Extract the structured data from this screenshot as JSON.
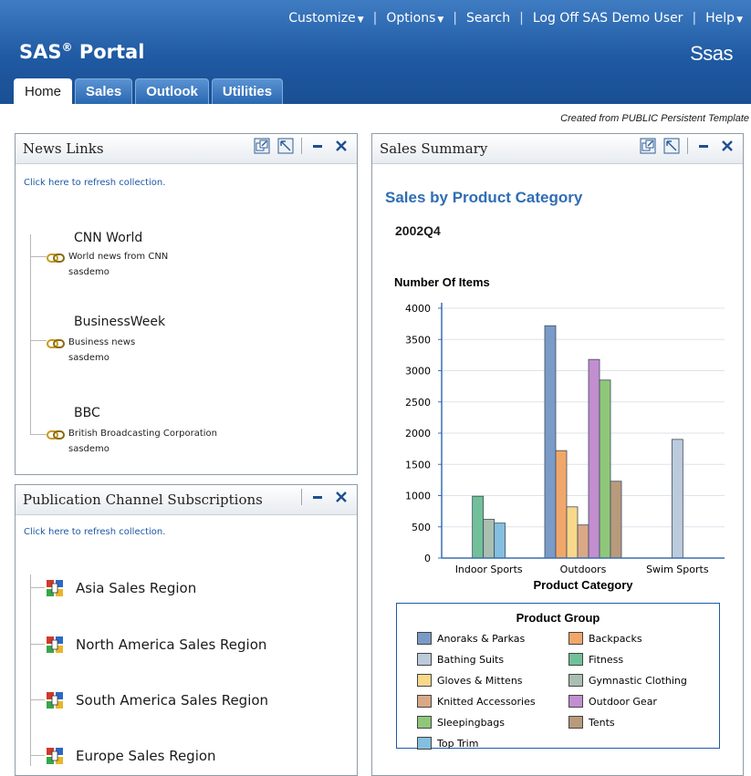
{
  "header": {
    "nav": [
      {
        "label": "Customize",
        "dropdown": true
      },
      {
        "label": "Options",
        "dropdown": true
      },
      {
        "label": "Search",
        "dropdown": false
      },
      {
        "label": "Log Off SAS Demo User",
        "dropdown": false
      },
      {
        "label": "Help",
        "dropdown": true
      }
    ],
    "portal_name": "SAS",
    "portal_reg": "®",
    "portal_suffix": "Portal",
    "logo_text": "Ssas",
    "tabs": [
      "Home",
      "Sales",
      "Outlook",
      "Utilities"
    ],
    "active_tab": "Home"
  },
  "template_note": "Created from PUBLIC Persistent Template",
  "news_links": {
    "title": "News Links",
    "refresh_text": "Click here to refresh collection.",
    "items": [
      {
        "title": "CNN World",
        "description": "World news from CNN",
        "owner": "sasdemo"
      },
      {
        "title": "BusinessWeek",
        "description": "Business news",
        "owner": "sasdemo"
      },
      {
        "title": "BBC",
        "description": "British Broadcasting Corporation",
        "owner": "sasdemo"
      }
    ]
  },
  "publication_channels": {
    "title": "Publication Channel Subscriptions",
    "refresh_text": "Click here to refresh collection.",
    "items": [
      "Asia Sales Region",
      "North America Sales Region",
      "South America Sales Region",
      "Europe Sales Region"
    ]
  },
  "sales_summary": {
    "title": "Sales Summary",
    "heading": "Sales by Product Category",
    "period": "2002Q4"
  },
  "chart_data": {
    "type": "bar",
    "title": "",
    "xlabel": "Product Category",
    "ylabel": "Number Of Items",
    "ylim": [
      0,
      4000
    ],
    "yticks": [
      0,
      500,
      1000,
      1500,
      2000,
      2500,
      3000,
      3500,
      4000
    ],
    "grid": true,
    "categories": [
      "Indoor Sports",
      "Outdoors",
      "Swim Sports"
    ],
    "legend_title": "Product Group",
    "legend_position": "bottom",
    "series": [
      {
        "name": "Anoraks & Parkas",
        "color": "#7a9bc7",
        "values": [
          null,
          3720,
          null
        ]
      },
      {
        "name": "Backpacks",
        "color": "#f1a76a",
        "values": [
          null,
          1720,
          null
        ]
      },
      {
        "name": "Bathing Suits",
        "color": "#bccbdc",
        "values": [
          null,
          null,
          1900
        ]
      },
      {
        "name": "Fitness",
        "color": "#72c09a",
        "values": [
          990,
          null,
          null
        ]
      },
      {
        "name": "Gloves & Mittens",
        "color": "#f8d88a",
        "values": [
          null,
          820,
          null
        ]
      },
      {
        "name": "Gymnastic Clothing",
        "color": "#a9bfb0",
        "values": [
          620,
          null,
          null
        ]
      },
      {
        "name": "Knitted Accessories",
        "color": "#d9a887",
        "values": [
          null,
          530,
          null
        ]
      },
      {
        "name": "Outdoor Gear",
        "color": "#c28ed0",
        "values": [
          null,
          3180,
          null
        ]
      },
      {
        "name": "Sleepingbags",
        "color": "#8fc77a",
        "values": [
          null,
          2850,
          null
        ]
      },
      {
        "name": "Tents",
        "color": "#b89a7c",
        "values": [
          null,
          1230,
          null
        ]
      },
      {
        "name": "Top Trim",
        "color": "#84bfe0",
        "values": [
          560,
          null,
          null
        ]
      }
    ]
  }
}
